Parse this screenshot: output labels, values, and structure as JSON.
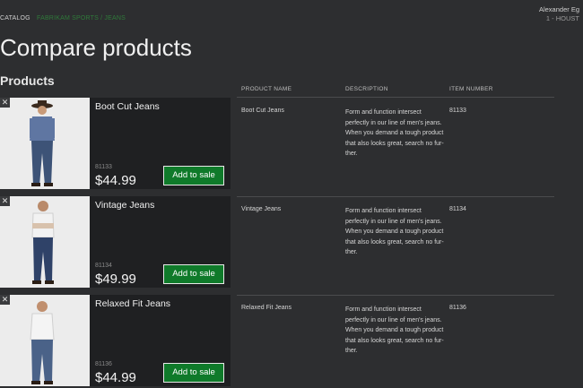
{
  "header": {
    "breadcrumb_catalog": "CATALOG",
    "breadcrumb_link": "FABRIKAM SPORTS / JEANS",
    "user_name": "Alexander Eg",
    "store": "1 - HOUST"
  },
  "page": {
    "title": "Compare products",
    "section_title": "Products"
  },
  "table": {
    "headers": [
      "PRODUCT NAME",
      "DESCRIPTION",
      "ITEM NUMBER"
    ]
  },
  "products": [
    {
      "name": "Boot Cut Jeans",
      "item_number": "81133",
      "price": "$44.99",
      "button": "Add to sale",
      "description": "Form and function intersect perfectly in our line of men's jeans. When you demand a tough product that also looks great, search no fur-ther."
    },
    {
      "name": "Vintage Jeans",
      "item_number": "81134",
      "price": "$49.99",
      "button": "Add to sale",
      "description": "Form and function intersect perfectly in our line of men's jeans. When you demand a tough product that also looks great, search no fur-ther."
    },
    {
      "name": "Relaxed Fit Jeans",
      "item_number": "81136",
      "price": "$44.99",
      "button": "Add to sale",
      "description": "Form and function intersect perfectly in our line of men's jeans. When you demand a tough product that also looks great, search no fur-ther."
    }
  ],
  "colors": {
    "background": "#2d2e30",
    "card": "#1f2022",
    "accent_button": "#0f7a2a",
    "link": "#2f7a3a"
  }
}
